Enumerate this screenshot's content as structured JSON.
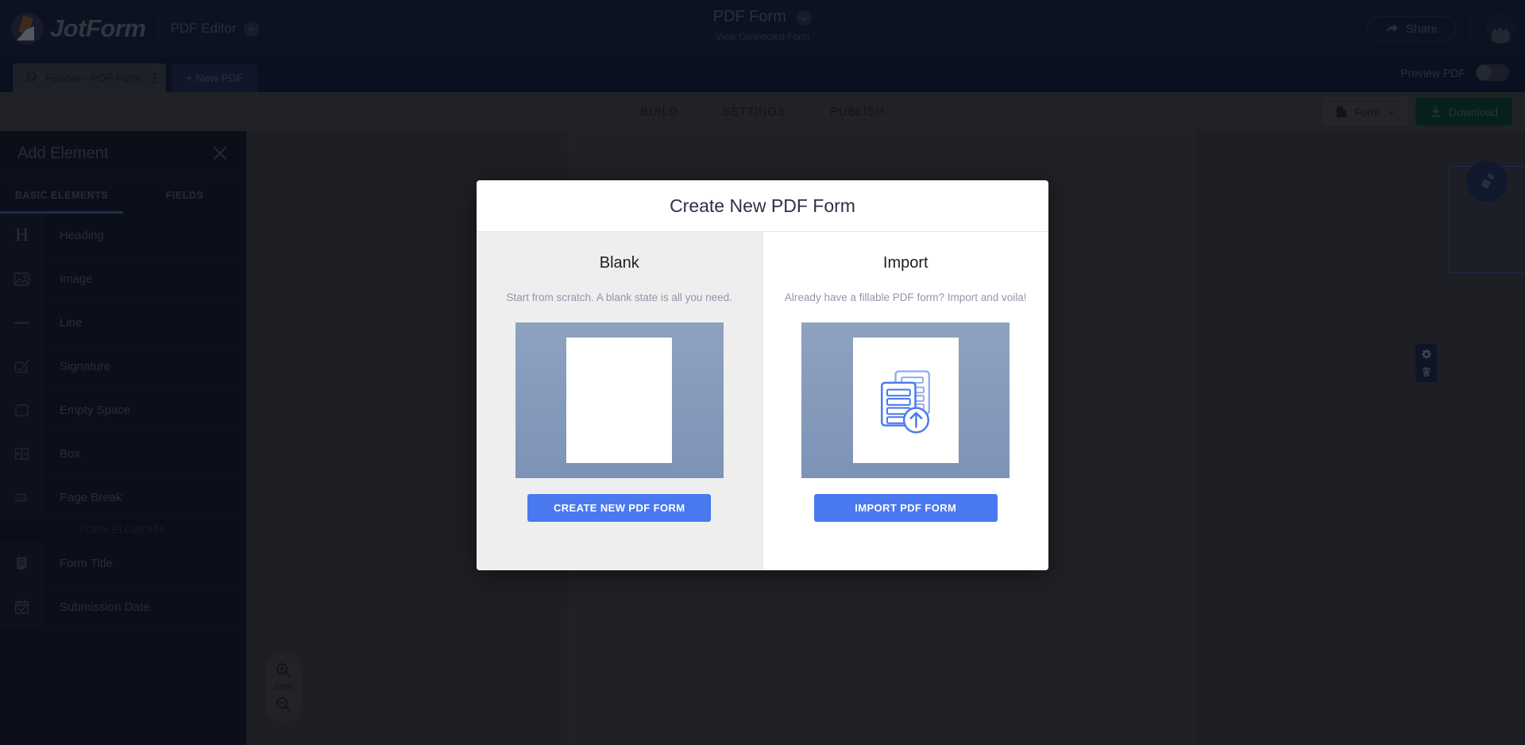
{
  "header": {
    "brand": "JotForm",
    "product": "PDF Editor",
    "title": "PDF Form",
    "subtitle": "View Connected Form",
    "share_label": "Share"
  },
  "tabstrip": {
    "file_tab": "Fillable - PDF Form",
    "new_pdf": "+ New PDF",
    "preview_label": "Preview PDF",
    "preview_on": false
  },
  "nav": {
    "items": [
      {
        "label": "BUILD"
      },
      {
        "label": "SETTINGS"
      },
      {
        "label": "PUBLISH"
      }
    ],
    "form_select": "Form",
    "download": "Download"
  },
  "sidebar": {
    "title": "Add Element",
    "tabs": [
      {
        "label": "BASIC ELEMENTS",
        "active": true
      },
      {
        "label": "FIELDS",
        "active": false
      }
    ],
    "basic_items": [
      {
        "label": "Heading",
        "icon": "heading-icon"
      },
      {
        "label": "Image",
        "icon": "image-icon"
      },
      {
        "label": "Line",
        "icon": "line-icon"
      },
      {
        "label": "Signature",
        "icon": "signature-icon"
      },
      {
        "label": "Empty Space",
        "icon": "empty-space-icon"
      },
      {
        "label": "Box",
        "icon": "box-icon"
      },
      {
        "label": "Page Break",
        "icon": "page-break-icon"
      }
    ],
    "section_label": "FORM ELEMENTS",
    "form_items": [
      {
        "label": "Form Title",
        "icon": "form-title-icon"
      },
      {
        "label": "Submission Date",
        "icon": "calendar-check-icon"
      }
    ]
  },
  "canvas": {
    "zoom_level": "100%"
  },
  "modal": {
    "title": "Create New PDF Form",
    "blank": {
      "title": "Blank",
      "description": "Start from scratch. A blank state is all you need.",
      "cta": "CREATE NEW PDF FORM"
    },
    "import": {
      "title": "Import",
      "description": "Already have a fillable PDF form? Import and voila!",
      "cta": "IMPORT PDF FORM"
    }
  },
  "colors": {
    "header_bg": "#101a35",
    "tabstrip_bg": "#0d1430",
    "navbar_bg": "#434343",
    "sidebar_bg": "#0c1020",
    "accent_blue": "#4a78ef",
    "tab_underline": "#3b5ca8",
    "download_green": "#043a22"
  }
}
